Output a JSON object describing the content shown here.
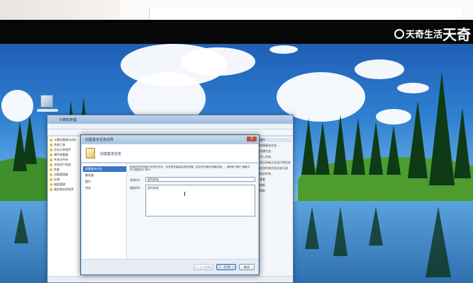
{
  "watermark": {
    "text": "天奇生活",
    "big": "天奇"
  },
  "management_window": {
    "title": "计算机管理",
    "tree_items": [
      "计算机管理(本地)",
      "系统工具",
      "任务计划程序",
      "事件查看器",
      "共享文件夹",
      "本地用户和组",
      "性能",
      "设备管理器",
      "存储",
      "磁盘管理",
      "服务和应用程序"
    ],
    "actions": [
      "操作",
      "创建基本任务...",
      "创建任务...",
      "导入任务...",
      "显示所有正在运行的任务",
      "启用所有任务历史记录",
      "新文件夹...",
      "查看",
      "刷新",
      "帮助"
    ],
    "status": ""
  },
  "wizard": {
    "title": "创建基本任务向导",
    "close_label": "X",
    "header_title": "创建基本任务",
    "steps": [
      "创建基本任务",
      "触发器",
      "操作",
      "完成"
    ],
    "active_step": 0,
    "description": "使用此向导快速计划常见任务。有关更多高级选项或设置（如多任务操作或触发器），请使用“操作”窗格中的“创建任务”命令。",
    "name_label": "名称(A):",
    "name_value": "定时关机",
    "desc_label": "描述(D):",
    "desc_value": "定时关机",
    "buttons": {
      "back": "< 上一步(B)",
      "next": "下一步(N) >",
      "cancel": "取消"
    }
  }
}
